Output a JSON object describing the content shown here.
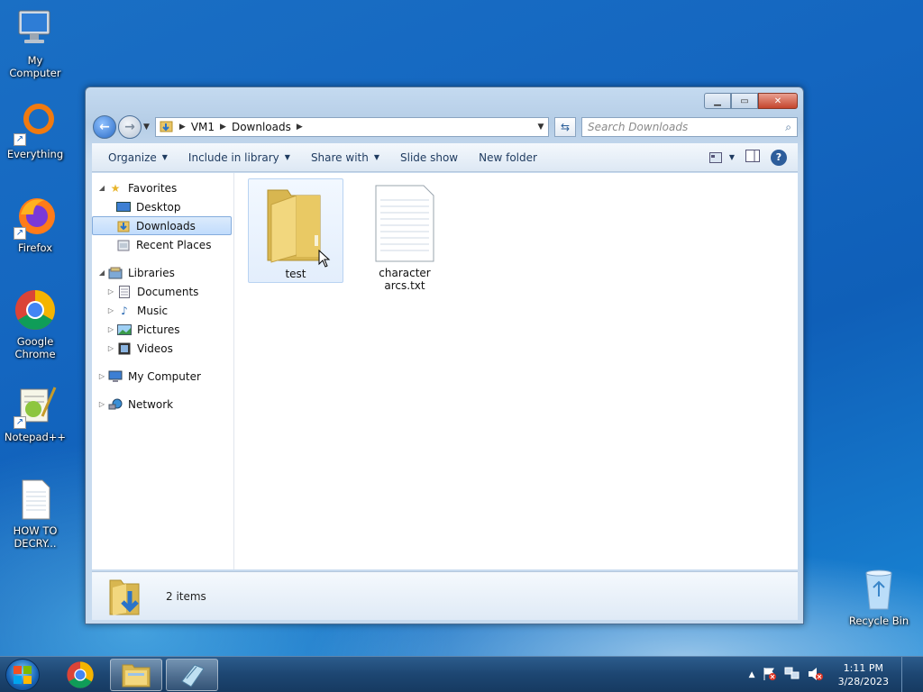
{
  "desktop": {
    "icons": [
      {
        "label": "My Computer",
        "icon": "computer-icon"
      },
      {
        "label": "Everything",
        "icon": "everything-icon"
      },
      {
        "label": "Firefox",
        "icon": "firefox-icon"
      },
      {
        "label": "Google Chrome",
        "icon": "chrome-icon"
      },
      {
        "label": "Notepad++",
        "icon": "notepadpp-icon"
      },
      {
        "label": "HOW TO DECRY...",
        "icon": "text-file-icon"
      },
      {
        "label": "Recycle Bin",
        "icon": "recycle-bin-icon"
      }
    ]
  },
  "explorer": {
    "address": {
      "segments": [
        "VM1",
        "Downloads"
      ]
    },
    "search": {
      "placeholder": "Search Downloads"
    },
    "toolbar": {
      "organize": "Organize",
      "include": "Include in library",
      "share": "Share with",
      "slideshow": "Slide show",
      "newfolder": "New folder"
    },
    "nav": {
      "favorites": "Favorites",
      "desktop": "Desktop",
      "downloads": "Downloads",
      "recent": "Recent Places",
      "libraries": "Libraries",
      "documents": "Documents",
      "music": "Music",
      "pictures": "Pictures",
      "videos": "Videos",
      "computer": "My Computer",
      "network": "Network"
    },
    "files": [
      {
        "name": "test",
        "type": "folder"
      },
      {
        "name": "character arcs.txt",
        "type": "text"
      }
    ],
    "status": {
      "count": "2 items"
    }
  },
  "taskbar": {
    "time": "1:11 PM",
    "date": "3/28/2023",
    "colors": {
      "accent": "#1d4672"
    }
  }
}
